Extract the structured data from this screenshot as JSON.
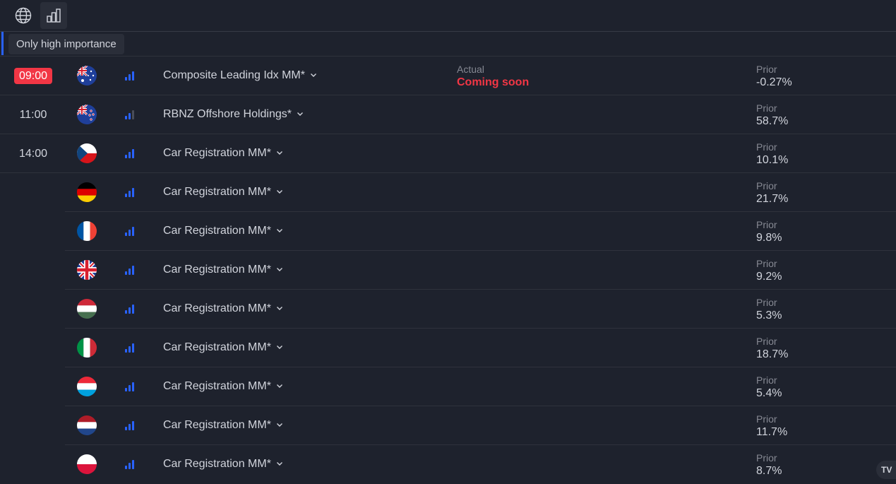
{
  "toolbar": {
    "tooltip": "Only high importance",
    "icons": [
      "globe-icon",
      "bar-chart-icon"
    ]
  },
  "colors": {
    "background": "#1e222d",
    "accent_blue": "#2962ff",
    "active_red": "#f23645",
    "muted_text": "#868993"
  },
  "labels": {
    "actual": "Actual",
    "prior": "Prior"
  },
  "events": [
    {
      "time": "09:00",
      "active": true,
      "country": "Australia",
      "flag": "au",
      "importance": "high",
      "name": "Composite Leading Idx MM*",
      "actual": "Coming soon",
      "prior": "-0.27%"
    },
    {
      "time": "11:00",
      "active": false,
      "country": "New Zealand",
      "flag": "nz",
      "importance": "medium",
      "name": "RBNZ Offshore Holdings*",
      "actual": "",
      "prior": "58.7%"
    },
    {
      "time": "14:00",
      "active": false,
      "country": "Czech Republic",
      "flag": "cz",
      "importance": "high",
      "name": "Car Registration MM*",
      "actual": "",
      "prior": "10.1%"
    },
    {
      "time": "",
      "active": false,
      "country": "Germany",
      "flag": "de",
      "importance": "high",
      "name": "Car Registration MM*",
      "actual": "",
      "prior": "21.7%"
    },
    {
      "time": "",
      "active": false,
      "country": "France",
      "flag": "fr",
      "importance": "high",
      "name": "Car Registration MM*",
      "actual": "",
      "prior": "9.8%"
    },
    {
      "time": "",
      "active": false,
      "country": "United Kingdom",
      "flag": "gb",
      "importance": "high",
      "name": "Car Registration MM*",
      "actual": "",
      "prior": "9.2%"
    },
    {
      "time": "",
      "active": false,
      "country": "Hungary",
      "flag": "hu",
      "importance": "high",
      "name": "Car Registration MM*",
      "actual": "",
      "prior": "5.3%"
    },
    {
      "time": "",
      "active": false,
      "country": "Italy",
      "flag": "it",
      "importance": "high",
      "name": "Car Registration MM*",
      "actual": "",
      "prior": "18.7%"
    },
    {
      "time": "",
      "active": false,
      "country": "Luxembourg",
      "flag": "lu",
      "importance": "high",
      "name": "Car Registration MM*",
      "actual": "",
      "prior": "5.4%"
    },
    {
      "time": "",
      "active": false,
      "country": "Netherlands",
      "flag": "nl",
      "importance": "high",
      "name": "Car Registration MM*",
      "actual": "",
      "prior": "11.7%"
    },
    {
      "time": "",
      "active": false,
      "country": "Poland",
      "flag": "pl",
      "importance": "high",
      "name": "Car Registration MM*",
      "actual": "",
      "prior": "8.7%"
    }
  ],
  "watermark": "TV"
}
